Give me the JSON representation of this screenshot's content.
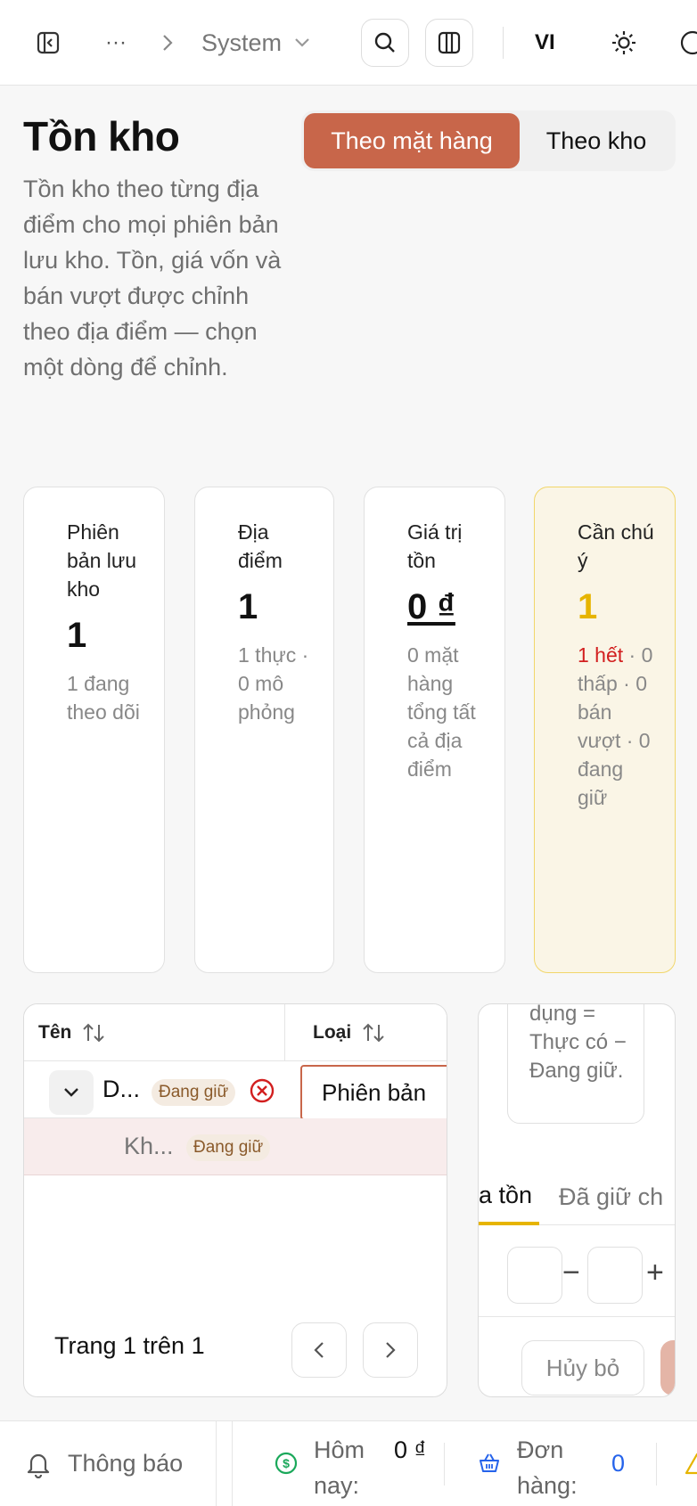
{
  "topbar": {
    "crumb_ellipsis": "···",
    "crumb_current": "System",
    "lang": "VI"
  },
  "header": {
    "title": "Tồn kho",
    "description": "Tồn kho theo từng địa điểm cho mọi phiên bản lưu kho. Tồn, giá vốn và bán vượt được chỉnh theo địa điểm — chọn một dòng để chỉnh.",
    "view_toggle": {
      "option_item": "Theo mặt hàng",
      "option_warehouse": "Theo kho",
      "selected": "Theo mặt hàng"
    }
  },
  "stats": {
    "variants": {
      "label": "Phiên bản lưu kho",
      "value": "1",
      "sub": "1 đang theo dõi"
    },
    "locations": {
      "label": "Địa điểm",
      "value": "1",
      "sub": "1 thực · 0 mô phỏng"
    },
    "stock_value": {
      "label": "Giá trị tồn",
      "value": "0 ₫",
      "sub": "0 mặt hàng tổng tất cả địa điểm"
    },
    "attention": {
      "label": "Cần chú ý",
      "value": "1",
      "sub_red": "1 hết",
      "sub": "· 0 thấp · 0 bán vượt · 0 đang giữ"
    }
  },
  "table": {
    "col_name": "Tên",
    "col_type": "Loại",
    "rows": [
      {
        "name": "D...",
        "badge": "Đang giữ",
        "type": "Phiên bản"
      },
      {
        "name": "Kh...",
        "badge": "Đang giữ"
      }
    ],
    "pager": "Trang 1 trên 1"
  },
  "side_panel": {
    "info_text": "dụng = Thực có − Đang giữ.",
    "tab_stock": "a tồn",
    "tab_reserved": "Đã giữ ch",
    "minus": "−",
    "plus": "+",
    "cancel_label": "Hủy bỏ"
  },
  "bottombar": {
    "notifications": "Thông báo",
    "today_label": "Hôm nay:",
    "today_value": "0 ₫",
    "orders_label": "Đơn hàng:",
    "orders_value": "0"
  },
  "colors": {
    "accent": "#c8664a",
    "warning": "#e6b400",
    "danger": "#d21f1f",
    "money": "#1aa85a",
    "orders": "#2563eb"
  }
}
